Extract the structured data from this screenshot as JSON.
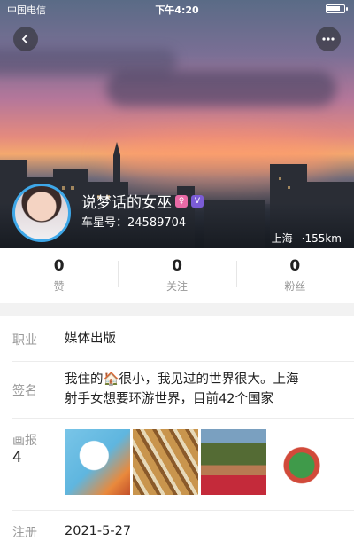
{
  "status_bar": {
    "carrier": "中国电信",
    "time": "下午4:20"
  },
  "profile": {
    "name": "说梦话的女巫",
    "badge_pink": "♀",
    "badge_purple": "V",
    "car_id": "车星号：24589704",
    "location": "上海",
    "distance": "·155km"
  },
  "stats": [
    {
      "value": "0",
      "label": "赞"
    },
    {
      "value": "0",
      "label": "关注"
    },
    {
      "value": "0",
      "label": "粉丝"
    }
  ],
  "info": {
    "job_label": "职业",
    "job_value": "媒体出版",
    "sign_label": "签名",
    "sign_line1": "我住的🏠很小，我见过的世界很大。上海",
    "sign_line2": "射手女想要环游世界，目前42个国家",
    "gallery_label": "画报",
    "gallery_count": "4",
    "register_label": "注册",
    "register_value": "2021-5-27"
  },
  "colors": {
    "accent_avatar_border": "#3ea7e8",
    "badge_pink": "#e86aa6",
    "badge_purple": "#7b5cd6"
  }
}
